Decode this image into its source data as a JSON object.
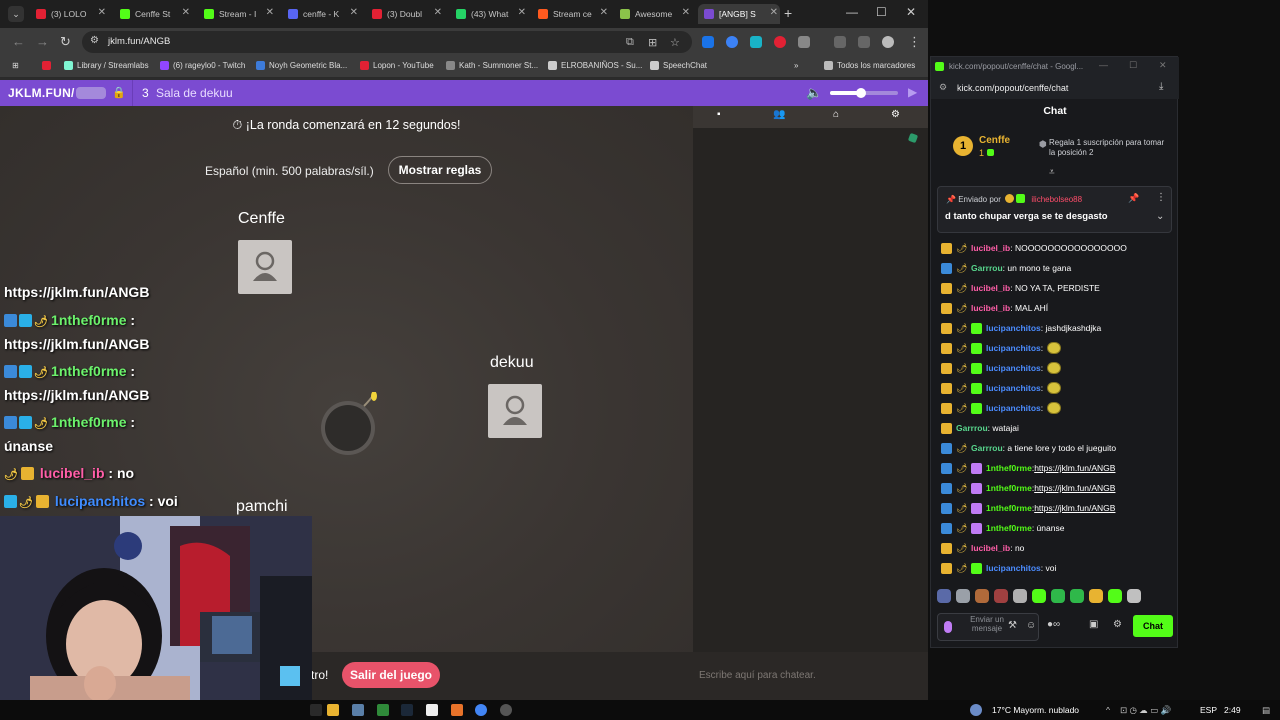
{
  "browser": {
    "tabs": [
      {
        "label": "(3) LOLO",
        "color": "#e22134"
      },
      {
        "label": "Cenffe St",
        "color": "#53fc18"
      },
      {
        "label": "Stream - I",
        "color": "#53fc18"
      },
      {
        "label": "cenffe - K",
        "color": "#5865f2"
      },
      {
        "label": "(3) Doubl",
        "color": "#e22134"
      },
      {
        "label": "(43) What",
        "color": "#25d366"
      },
      {
        "label": "Stream ce",
        "color": "#ff5a1f"
      },
      {
        "label": "Awesome",
        "color": "#8bc34a"
      },
      {
        "label": "[ANGB] S",
        "color": "#7b4bd1"
      }
    ],
    "url": "jklm.fun/ANGB",
    "bookmarks": [
      {
        "label": "",
        "color": "#e22134"
      },
      {
        "label": "Library / Streamlabs",
        "color": "#80f5d2"
      },
      {
        "label": "(6) rageylo0 - Twitch",
        "color": "#9146ff"
      },
      {
        "label": "Noyh Geometric Bla...",
        "color": "#3d7bd9"
      },
      {
        "label": "Lopon - YouTube",
        "color": "#e22134"
      },
      {
        "label": "Kath - Summoner St...",
        "color": "#888888"
      },
      {
        "label": "ELROBANIÑOS - Su...",
        "color": "#cccccc"
      },
      {
        "label": "SpeechChat",
        "color": "#cccccc"
      }
    ],
    "all_bookmarks": "Todos los marcadores"
  },
  "jklm": {
    "brand": "JKLM.FUN/",
    "player_count": "3",
    "room_name": "Sala de dekuu",
    "volume": 0.45,
    "round_msg": "¡La ronda comenzará en 12 segundos!",
    "language": "Español (min. 500 palabras/síl.)",
    "rules_btn": "Mostrar reglas",
    "players": [
      "Cenffe",
      "dekuu",
      "pamchi"
    ],
    "footer_text": "tro!",
    "leave_btn": "Salir del juego",
    "chat_placeholder": "Escribe aquí para chatear."
  },
  "overlay": {
    "lines": [
      {
        "user": "",
        "text": "https://jklm.fun/ANGB"
      },
      {
        "user": "1nthef0rme",
        "text": ":"
      },
      {
        "user": "",
        "text": "https://jklm.fun/ANGB"
      },
      {
        "user": "1nthef0rme",
        "text": ":"
      },
      {
        "user": "",
        "text": "https://jklm.fun/ANGB"
      },
      {
        "user": "1nthef0rme",
        "text": ":"
      },
      {
        "user": "",
        "text": "únanse"
      },
      {
        "user": "lucibel_ib",
        "text": ": no"
      },
      {
        "user": "lucipanchitos",
        "text": ": voi"
      }
    ]
  },
  "kick": {
    "window_title": "kick.com/popout/cenffe/chat - Googl...",
    "url": "kick.com/popout/cenffe/chat",
    "chat_title": "Chat",
    "sub": {
      "rank": "1",
      "name": "Cenffe",
      "count": "1",
      "text": "Regala 1 suscripción para tomar la posición 2"
    },
    "pinned": {
      "prefix": "Enviado por",
      "user": "ilichebolseo88",
      "message": "d tanto chupar verga se te desgasto"
    },
    "messages": [
      {
        "user": "lucibel_ib",
        "color": "pink",
        "badges": [
          "crown",
          "pepper"
        ],
        "text": ": NOOOOOOOOOOOOOOOO",
        "link": false,
        "emote": false
      },
      {
        "user": "Garrrou",
        "color": "green",
        "badges": [
          "blue",
          "pepper"
        ],
        "text": ": un mono te gana",
        "link": false,
        "emote": false
      },
      {
        "user": "lucibel_ib",
        "color": "pink",
        "badges": [
          "crown",
          "pepper"
        ],
        "text": ": NO YA TA, PERDISTE",
        "link": false,
        "emote": false
      },
      {
        "user": "lucibel_ib",
        "color": "pink",
        "badges": [
          "crown",
          "pepper"
        ],
        "text": ": MAL AHÍ",
        "link": false,
        "emote": false
      },
      {
        "user": "lucipanchitos",
        "color": "blue",
        "badges": [
          "crown",
          "pepper",
          "gift"
        ],
        "text": ": jashdjkashdjka",
        "link": false,
        "emote": false
      },
      {
        "user": "lucipanchitos",
        "color": "blue",
        "badges": [
          "crown",
          "pepper",
          "gift"
        ],
        "text": ":",
        "link": false,
        "emote": true
      },
      {
        "user": "lucipanchitos",
        "color": "blue",
        "badges": [
          "crown",
          "pepper",
          "gift"
        ],
        "text": ":",
        "link": false,
        "emote": true
      },
      {
        "user": "lucipanchitos",
        "color": "blue",
        "badges": [
          "crown",
          "pepper",
          "gift"
        ],
        "text": ":",
        "link": false,
        "emote": true
      },
      {
        "user": "lucipanchitos",
        "color": "blue",
        "badges": [
          "crown",
          "pepper",
          "gift"
        ],
        "text": ":",
        "link": false,
        "emote": true
      },
      {
        "user": "Garrrou",
        "color": "green",
        "badges": [
          "crown"
        ],
        "text": ": watajai",
        "link": false,
        "emote": false
      },
      {
        "user": "Garrrou",
        "color": "green",
        "badges": [
          "blue",
          "pepper"
        ],
        "text": ": a tiene lore y todo el jueguito",
        "link": false,
        "emote": false
      },
      {
        "user": "1nthef0rme",
        "color": "lime",
        "badges": [
          "blue",
          "pepper",
          "gift2"
        ],
        "text": "https://jklm.fun/ANGB",
        "link": true,
        "emote": false
      },
      {
        "user": "1nthef0rme",
        "color": "lime",
        "badges": [
          "blue",
          "pepper",
          "gift2"
        ],
        "text": "https://jklm.fun/ANGB",
        "link": true,
        "emote": false
      },
      {
        "user": "1nthef0rme",
        "color": "lime",
        "badges": [
          "blue",
          "pepper",
          "gift2"
        ],
        "text": "https://jklm.fun/ANGB",
        "link": true,
        "emote": false
      },
      {
        "user": "1nthef0rme",
        "color": "lime",
        "badges": [
          "blue",
          "pepper",
          "gift2"
        ],
        "text": ": únanse",
        "link": false,
        "emote": false
      },
      {
        "user": "lucibel_ib",
        "color": "pink",
        "badges": [
          "crown",
          "pepper"
        ],
        "text": ": no",
        "link": false,
        "emote": false
      },
      {
        "user": "lucipanchitos",
        "color": "blue",
        "badges": [
          "crown",
          "pepper",
          "gift"
        ],
        "text": ": voi",
        "link": false,
        "emote": false
      }
    ],
    "input_placeholder": "Enviar un mensaje",
    "chat_button": "Chat"
  },
  "taskbar": {
    "weather": "17°C  Mayorm. nublado",
    "lang": "ESP",
    "time": "2:49"
  }
}
